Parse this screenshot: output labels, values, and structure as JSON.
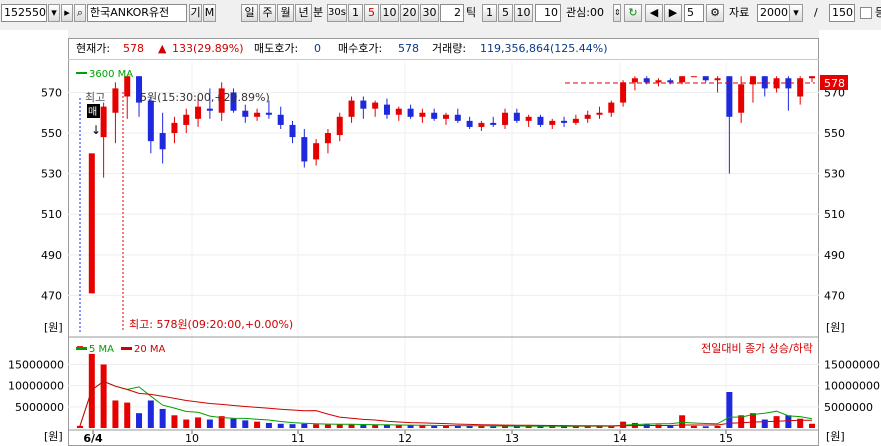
{
  "toolbar": {
    "code": "152550",
    "name": "한국ANKOR유전",
    "name_suffix": "기",
    "m_label": "M",
    "period_tabs": [
      "일",
      "주",
      "월",
      "년",
      "분"
    ],
    "min_tabs": [
      "30s",
      "1",
      "5",
      "10",
      "20",
      "30"
    ],
    "selected_min": "5",
    "tick_value": "2",
    "tick_label": "틱",
    "tick_tabs": [
      "1",
      "5",
      "10"
    ],
    "tick_input": "10",
    "watch_label": "관심:00",
    "step_value": "5",
    "data_label": "자료",
    "data_count": "2000",
    "slash": "/",
    "page_value": "150",
    "extra_label": "등"
  },
  "info": {
    "price_label": "현재가:",
    "price": "578",
    "change": "133(29.89%)",
    "ask_label": "매도호가:",
    "ask": "0",
    "bid_label": "매수호가:",
    "bid": "578",
    "volume_label": "거래량:",
    "volume": "119,356,864(125.44%)"
  },
  "colors": {
    "up": "#e60000",
    "down": "#1e28dc",
    "ma_green": "#00a000",
    "ma_red": "#d00000"
  },
  "chart_data": [
    {
      "type": "candlestick",
      "legend": [
        "3600 MA"
      ],
      "y_ticks": [
        470,
        490,
        510,
        530,
        550,
        570
      ],
      "ylim": [
        450,
        585
      ],
      "unit_label": "[원]",
      "current_price_tag": "578",
      "annotations": {
        "high_label": "최고: 578원(09:20:00,+0.00%)",
        "top_label": "최고",
        "marker_label": "5원(15:30:00,+29.89%)",
        "buy_tag": "매"
      },
      "candles": [
        {
          "o": 445,
          "h": 445,
          "l": 445,
          "c": 445
        },
        {
          "o": 471,
          "h": 471,
          "l": 471,
          "c": 540
        },
        {
          "o": 548,
          "h": 565,
          "l": 528,
          "c": 563
        },
        {
          "o": 560,
          "h": 575,
          "l": 545,
          "c": 572
        },
        {
          "o": 568,
          "h": 578,
          "l": 557,
          "c": 578
        },
        {
          "o": 578,
          "h": 578,
          "l": 558,
          "c": 565
        },
        {
          "o": 566,
          "h": 568,
          "l": 540,
          "c": 546
        },
        {
          "o": 550,
          "h": 560,
          "l": 535,
          "c": 542
        },
        {
          "o": 550,
          "h": 558,
          "l": 545,
          "c": 555
        },
        {
          "o": 554,
          "h": 562,
          "l": 550,
          "c": 559
        },
        {
          "o": 557,
          "h": 568,
          "l": 553,
          "c": 563
        },
        {
          "o": 562,
          "h": 572,
          "l": 557,
          "c": 561
        },
        {
          "o": 560,
          "h": 575,
          "l": 556,
          "c": 572
        },
        {
          "o": 570,
          "h": 572,
          "l": 560,
          "c": 561
        },
        {
          "o": 561,
          "h": 564,
          "l": 555,
          "c": 558
        },
        {
          "o": 558,
          "h": 562,
          "l": 556,
          "c": 560
        },
        {
          "o": 560,
          "h": 566,
          "l": 557,
          "c": 559
        },
        {
          "o": 559,
          "h": 563,
          "l": 552,
          "c": 554
        },
        {
          "o": 554,
          "h": 556,
          "l": 545,
          "c": 548
        },
        {
          "o": 548,
          "h": 552,
          "l": 533,
          "c": 536
        },
        {
          "o": 537,
          "h": 547,
          "l": 534,
          "c": 545
        },
        {
          "o": 545,
          "h": 552,
          "l": 540,
          "c": 550
        },
        {
          "o": 549,
          "h": 560,
          "l": 546,
          "c": 558
        },
        {
          "o": 558,
          "h": 568,
          "l": 555,
          "c": 566
        },
        {
          "o": 566,
          "h": 568,
          "l": 557,
          "c": 562
        },
        {
          "o": 562,
          "h": 566,
          "l": 558,
          "c": 565
        },
        {
          "o": 564,
          "h": 567,
          "l": 557,
          "c": 559
        },
        {
          "o": 559,
          "h": 563,
          "l": 556,
          "c": 562
        },
        {
          "o": 562,
          "h": 564,
          "l": 557,
          "c": 558
        },
        {
          "o": 558,
          "h": 562,
          "l": 555,
          "c": 560
        },
        {
          "o": 560,
          "h": 562,
          "l": 556,
          "c": 557
        },
        {
          "o": 557,
          "h": 560,
          "l": 554,
          "c": 559
        },
        {
          "o": 559,
          "h": 562,
          "l": 555,
          "c": 556
        },
        {
          "o": 556,
          "h": 558,
          "l": 552,
          "c": 553
        },
        {
          "o": 553,
          "h": 556,
          "l": 551,
          "c": 555
        },
        {
          "o": 555,
          "h": 558,
          "l": 553,
          "c": 554
        },
        {
          "o": 554,
          "h": 562,
          "l": 552,
          "c": 560
        },
        {
          "o": 560,
          "h": 562,
          "l": 555,
          "c": 556
        },
        {
          "o": 556,
          "h": 559,
          "l": 553,
          "c": 558
        },
        {
          "o": 558,
          "h": 559,
          "l": 553,
          "c": 554
        },
        {
          "o": 554,
          "h": 557,
          "l": 552,
          "c": 556
        },
        {
          "o": 556,
          "h": 558,
          "l": 553,
          "c": 555
        },
        {
          "o": 555,
          "h": 559,
          "l": 554,
          "c": 557
        },
        {
          "o": 557,
          "h": 561,
          "l": 555,
          "c": 559
        },
        {
          "o": 559,
          "h": 563,
          "l": 557,
          "c": 560
        },
        {
          "o": 560,
          "h": 566,
          "l": 558,
          "c": 565
        },
        {
          "o": 565,
          "h": 576,
          "l": 563,
          "c": 575
        },
        {
          "o": 575,
          "h": 578,
          "l": 571,
          "c": 577
        },
        {
          "o": 577,
          "h": 578,
          "l": 574,
          "c": 575
        },
        {
          "o": 575,
          "h": 577,
          "l": 573,
          "c": 576
        },
        {
          "o": 576,
          "h": 577,
          "l": 574,
          "c": 575
        },
        {
          "o": 575,
          "h": 578,
          "l": 574,
          "c": 578
        },
        {
          "o": 578,
          "h": 578,
          "l": 578,
          "c": 578
        },
        {
          "o": 578,
          "h": 578,
          "l": 575,
          "c": 576
        },
        {
          "o": 576,
          "h": 578,
          "l": 570,
          "c": 577
        },
        {
          "o": 578,
          "h": 578,
          "l": 530,
          "c": 558
        },
        {
          "o": 560,
          "h": 578,
          "l": 555,
          "c": 574
        },
        {
          "o": 574,
          "h": 578,
          "l": 565,
          "c": 578
        },
        {
          "o": 578,
          "h": 578,
          "l": 568,
          "c": 572
        },
        {
          "o": 572,
          "h": 578,
          "l": 570,
          "c": 577
        },
        {
          "o": 577,
          "h": 578,
          "l": 561,
          "c": 572
        },
        {
          "o": 568,
          "h": 578,
          "l": 564,
          "c": 577
        },
        {
          "o": 577,
          "h": 578,
          "l": 575,
          "c": 578
        }
      ]
    },
    {
      "type": "bar",
      "legend": [
        "5 MA",
        "20 MA"
      ],
      "legend_colors": [
        "#00a000",
        "#d00000"
      ],
      "right_note": "전일대비 종가 상승/하락",
      "y_ticks": [
        5000000,
        10000000,
        15000000
      ],
      "y_tick_labels": [
        "5000000",
        "10000000",
        "15000000"
      ],
      "ylim": [
        0,
        17000000
      ],
      "unit_label": "[원]",
      "x_labels": [
        "6/4",
        "10",
        "11",
        "12",
        "13",
        "14",
        "15"
      ],
      "volumes": [
        500000,
        17500000,
        15000000,
        6500000,
        6000000,
        3500000,
        6500000,
        4500000,
        3000000,
        2000000,
        2500000,
        2000000,
        2800000,
        2200000,
        1800000,
        1500000,
        1200000,
        1000000,
        900000,
        1000000,
        900000,
        800000,
        900000,
        800000,
        700000,
        700000,
        800000,
        600000,
        600000,
        600000,
        500000,
        600000,
        500000,
        500000,
        500000,
        400000,
        500000,
        400000,
        400000,
        400000,
        500000,
        400000,
        400000,
        500000,
        500000,
        400000,
        1500000,
        1200000,
        1000000,
        800000,
        600000,
        3000000,
        500000,
        400000,
        500000,
        8500000,
        3000000,
        3500000,
        2000000,
        2800000,
        3000000,
        2200000,
        1000000
      ]
    }
  ]
}
